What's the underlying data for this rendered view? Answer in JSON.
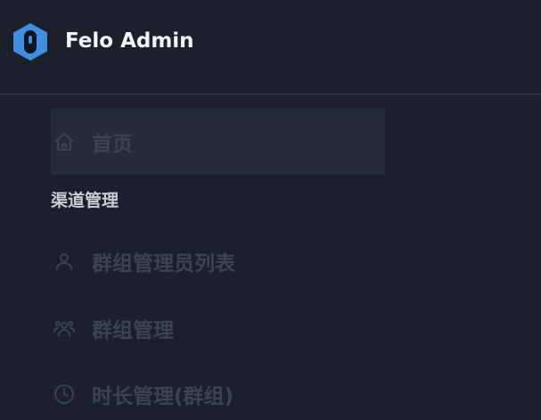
{
  "app": {
    "title": "Felo Admin"
  },
  "nav": {
    "home_label": "首页",
    "section_title": "渠道管理",
    "items": [
      {
        "label": "群组管理员列表",
        "icon": "user-icon"
      },
      {
        "label": "群组管理",
        "icon": "users-icon"
      },
      {
        "label": "时长管理(群组)",
        "icon": "clock-icon"
      }
    ]
  },
  "colors": {
    "background": "#1b202b",
    "active_item_bg": "#252c38",
    "logo": "#3f8ee0",
    "muted_text": "#3c4350",
    "title_text": "#f2f4f7",
    "section_text": "#c9ccd3"
  }
}
